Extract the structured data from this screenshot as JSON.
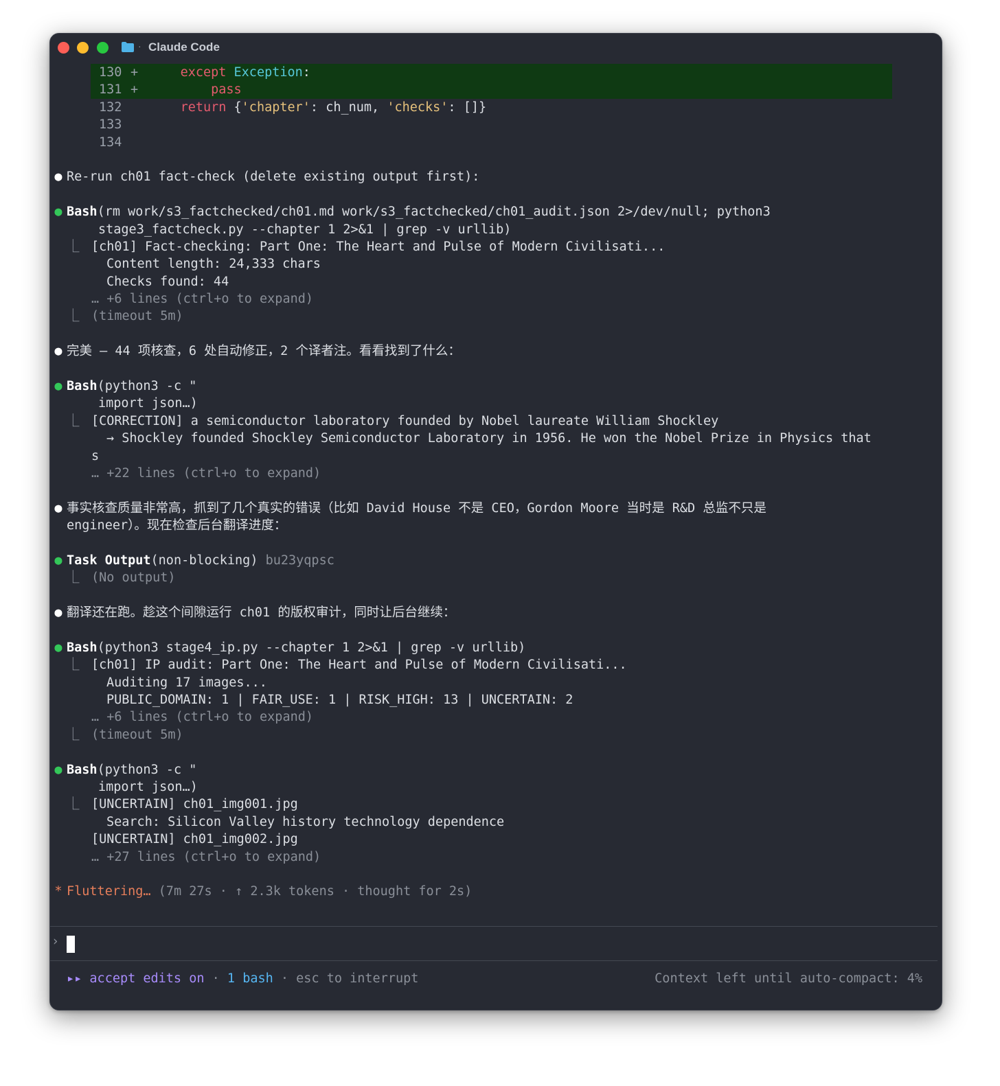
{
  "window": {
    "title": "Claude Code",
    "separator": "·"
  },
  "diff": [
    {
      "num": "130",
      "mark": "+",
      "added": true,
      "parts": [
        {
          "t": "    ",
          "c": ""
        },
        {
          "t": "except",
          "c": "kw"
        },
        {
          "t": " ",
          "c": ""
        },
        {
          "t": "Exception",
          "c": "cls"
        },
        {
          "t": ":",
          "c": ""
        }
      ]
    },
    {
      "num": "131",
      "mark": "+",
      "added": true,
      "parts": [
        {
          "t": "        ",
          "c": ""
        },
        {
          "t": "pass",
          "c": "kw"
        }
      ]
    },
    {
      "num": "132",
      "mark": "",
      "added": false,
      "parts": [
        {
          "t": "    ",
          "c": ""
        },
        {
          "t": "return",
          "c": "kw"
        },
        {
          "t": " {",
          "c": ""
        },
        {
          "t": "'chapter'",
          "c": "str"
        },
        {
          "t": ": ch_num, ",
          "c": ""
        },
        {
          "t": "'checks'",
          "c": "str"
        },
        {
          "t": ": []}",
          "c": ""
        }
      ]
    },
    {
      "num": "133",
      "mark": "",
      "added": false,
      "parts": []
    },
    {
      "num": "134",
      "mark": "",
      "added": false,
      "parts": []
    }
  ],
  "bullet_glyph": "●",
  "corner_glyph": "⎿",
  "messages": {
    "m1": "Re-run ch01 fact-check (delete existing output first):",
    "bash1": {
      "tool": "Bash",
      "cmd1": "(rm work/s3_factchecked/ch01.md work/s3_factchecked/ch01_audit.json 2>/dev/null; python3",
      "cmd2": "stage3_factcheck.py --chapter 1 2>&1 | grep -v urllib)",
      "out1": "[ch01] Fact-checking: Part One: The Heart and Pulse of Modern Civilisati...",
      "out2": "Content length: 24,333 chars",
      "out3": "Checks found: 44",
      "more": "… +6 lines (ctrl+o to expand)",
      "timeout": "(timeout 5m)"
    },
    "m2": "完美 — 44 项核查，6 处自动修正，2 个译者注。看看找到了什么：",
    "bash2": {
      "tool": "Bash",
      "cmd1": "(python3 -c \"",
      "cmd2": "import json…)",
      "out1": "[CORRECTION] a semiconductor laboratory founded by Nobel laureate William Shockley",
      "out2": "→ Shockley founded Shockley Semiconductor Laboratory in 1956. He won the Nobel Prize in Physics that",
      "out3": "s",
      "more": "… +22 lines (ctrl+o to expand)"
    },
    "m3_l1": "事实核查质量非常高，抓到了几个真实的错误（比如 David House 不是 CEO，Gordon Moore 当时是 R&D 总监不只是",
    "m3_l2": "engineer）。现在检查后台翻译进度：",
    "task": {
      "tool": "Task Output",
      "args": "(non-blocking)",
      "id": " bu23yqpsc",
      "out1": "(No output)"
    },
    "m4": "翻译还在跑。趁这个间隙运行 ch01 的版权审计，同时让后台继续：",
    "bash3": {
      "tool": "Bash",
      "cmd1": "(python3 stage4_ip.py --chapter 1 2>&1 | grep -v urllib)",
      "out1": "[ch01] IP audit: Part One: The Heart and Pulse of Modern Civilisati...",
      "out2": "Auditing 17 images...",
      "out3": "PUBLIC_DOMAIN: 1 | FAIR_USE: 1 | RISK_HIGH: 13 | UNCERTAIN: 2",
      "more": "… +6 lines (ctrl+o to expand)",
      "timeout": "(timeout 5m)"
    },
    "bash4": {
      "tool": "Bash",
      "cmd1": "(python3 -c \"",
      "cmd2": "import json…)",
      "out1": "[UNCERTAIN] ch01_img001.jpg",
      "out2": "Search: Silicon Valley history technology dependence",
      "out3": "[UNCERTAIN] ch01_img002.jpg",
      "more": "… +27 lines (ctrl+o to expand)"
    }
  },
  "status": {
    "spinner": "*",
    "label": "Fluttering…",
    "details": " (7m 27s · ↑ 2.3k tokens · thought for 2s)"
  },
  "prompt": {
    "glyph": "›",
    "value": ""
  },
  "footer": {
    "arrows": "▸▸",
    "mode": " accept edits on",
    "sep1": " · ",
    "bash_count": "1 bash",
    "sep2": " · ",
    "hint": "esc to interrupt",
    "context": "Context left until auto-compact: 4%"
  },
  "colors": {
    "background": "#272a33",
    "diff_add_bg": "#0f3a13",
    "bullet_ok": "#34c759",
    "spinner": "#e67e5a",
    "mode": "#a78bfa"
  }
}
